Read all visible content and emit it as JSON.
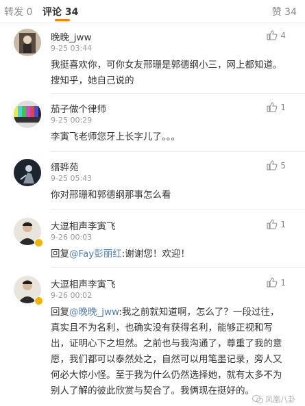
{
  "tabs": {
    "repost": "转发 0",
    "comment": "评论 34",
    "like": "赞 34"
  },
  "comments": [
    {
      "username": "晚晚_jww",
      "timestamp": "9-25 03:44",
      "likes": "4",
      "text": "我挺喜欢你，可你女友邢珊是郭德纲小三，网上都知道。搜知乎，她自己说的"
    },
    {
      "username": "茄子做个律师",
      "timestamp": "9-25 00:29",
      "likes": "1",
      "text": "李寅飞老师您牙上长字儿了。。。"
    },
    {
      "username": "缙骅苑",
      "timestamp": "9-25 05:43",
      "likes": "5",
      "text": "你对邢珊和郭德纲那事怎么看"
    },
    {
      "username": "大逗相声李寅飞",
      "timestamp": "9-26 00:03",
      "likes": "1",
      "reply_prefix": "回复",
      "mention": "@Fay彭丽红",
      "text": ":谢谢您！欢迎！"
    },
    {
      "username": "大逗相声李寅飞",
      "timestamp": "9-26 00:02",
      "likes": "1",
      "reply_prefix": "回复",
      "mention": "@晚晚_jww",
      "text": ":我之前就知道啊，怎么了？一段过往，真实且不为名利，也确实没有获得名利，能够正视和写出，证明心下之坦然。之前也与我沟通了，尊重了我的意愿，我们都可以泰然处之，自然可以用笔墨记录，旁人又何必大惊小怪。至于我为什么仍然选择她，就有太多不为别人了解的彼此欣赏与契合了。我俩现在挺好的。"
    }
  ],
  "watermark": "凤凰八卦",
  "colors": {
    "accent": "#ff8200",
    "mention": "#507daf",
    "verified_badge": "#f4b400"
  },
  "icons": [
    "thumbs-up-icon",
    "verified-badge-icon",
    "avatar"
  ]
}
